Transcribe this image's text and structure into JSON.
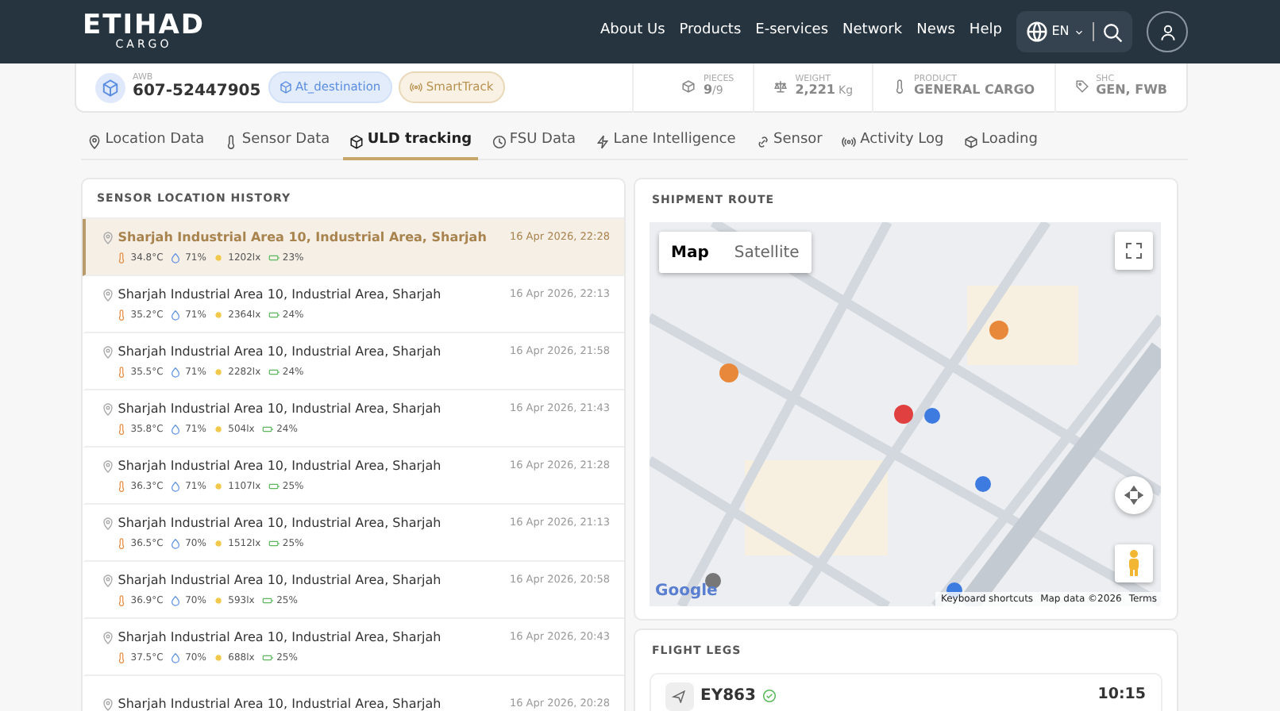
{
  "header": {
    "logo": "ETIHAD",
    "logo_sub": "CARGO",
    "nav": [
      "About Us",
      "Products",
      "E-services",
      "Network",
      "News",
      "Help"
    ],
    "language": "EN"
  },
  "summary": {
    "awb_label": "AWB",
    "awb": "607-52447905",
    "badges": [
      {
        "kind": "status",
        "text": "At_destination"
      },
      {
        "kind": "tracker",
        "text": "SmartTrack"
      }
    ],
    "stats": [
      {
        "kind": "pieces",
        "label": "PIECES",
        "value": "9",
        "unit": "/9"
      },
      {
        "kind": "weight",
        "label": "WEIGHT",
        "value": "2,221",
        "unit": "Kg"
      },
      {
        "kind": "product",
        "label": "PRODUCT",
        "value": "GENERAL CARGO"
      },
      {
        "kind": "shc",
        "label": "SHC",
        "value": "GEN, FWB"
      }
    ]
  },
  "tabs": [
    {
      "kind": "location",
      "label": "Location Data",
      "selected": false
    },
    {
      "kind": "sensor",
      "label": "Sensor Data",
      "selected": false
    },
    {
      "kind": "uld",
      "label": "ULD tracking",
      "selected": true
    },
    {
      "kind": "fsu",
      "label": "FSU Data",
      "selected": false
    },
    {
      "kind": "lane",
      "label": "Lane Intelligence",
      "selected": false
    },
    {
      "kind": "link",
      "label": "Sensor",
      "selected": false
    },
    {
      "kind": "activity",
      "label": "Activity Log",
      "selected": false
    },
    {
      "kind": "loading",
      "label": "Loading",
      "selected": false
    }
  ],
  "history": {
    "title": "SENSOR LOCATION HISTORY",
    "rows": [
      {
        "address": "Sharjah Industrial Area 10, Industrial Area, Sharjah",
        "time": "16 Apr 2026, 22:28",
        "temperature": "34.8°C",
        "humidity": "71%",
        "light": "1202lx",
        "battery": "23%",
        "selected": true
      },
      {
        "address": "Sharjah Industrial Area 10, Industrial Area, Sharjah",
        "time": "16 Apr 2026, 22:13",
        "temperature": "35.2°C",
        "humidity": "71%",
        "light": "2364lx",
        "battery": "24%",
        "selected": false
      },
      {
        "address": "Sharjah Industrial Area 10, Industrial Area, Sharjah",
        "time": "16 Apr 2026, 21:58",
        "temperature": "35.5°C",
        "humidity": "71%",
        "light": "2282lx",
        "battery": "24%",
        "selected": false
      },
      {
        "address": "Sharjah Industrial Area 10, Industrial Area, Sharjah",
        "time": "16 Apr 2026, 21:43",
        "temperature": "35.8°C",
        "humidity": "71%",
        "light": "504lx",
        "battery": "24%",
        "selected": false
      },
      {
        "address": "Sharjah Industrial Area 10, Industrial Area, Sharjah",
        "time": "16 Apr 2026, 21:28",
        "temperature": "36.3°C",
        "humidity": "71%",
        "light": "1107lx",
        "battery": "25%",
        "selected": false
      },
      {
        "address": "Sharjah Industrial Area 10, Industrial Area, Sharjah",
        "time": "16 Apr 2026, 21:13",
        "temperature": "36.5°C",
        "humidity": "70%",
        "light": "1512lx",
        "battery": "25%",
        "selected": false
      },
      {
        "address": "Sharjah Industrial Area 10, Industrial Area, Sharjah",
        "time": "16 Apr 2026, 20:58",
        "temperature": "36.9°C",
        "humidity": "70%",
        "light": "593lx",
        "battery": "25%",
        "selected": false
      },
      {
        "address": "Sharjah Industrial Area 10, Industrial Area, Sharjah",
        "time": "16 Apr 2026, 20:43",
        "temperature": "37.5°C",
        "humidity": "70%",
        "light": "688lx",
        "battery": "25%",
        "selected": false
      },
      {
        "address": "Sharjah Industrial Area 10, Industrial Area, Sharjah",
        "time": "16 Apr 2026, 20:28",
        "selected": false
      }
    ]
  },
  "route": {
    "title": "SHIPMENT ROUTE",
    "map_types": [
      {
        "label": "Map",
        "selected": true
      },
      {
        "label": "Satellite",
        "selected": false
      }
    ],
    "google": "Google",
    "attribution": [
      "Keyboard shortcuts",
      "Map data ©2026",
      "Terms"
    ]
  },
  "flight_legs": {
    "title": "FLIGHT LEGS",
    "legs": [
      {
        "flight": "EY863",
        "time": "10:15",
        "confirmed": true
      }
    ]
  }
}
